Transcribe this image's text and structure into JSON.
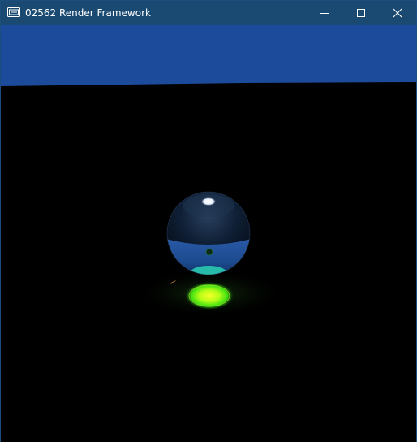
{
  "window": {
    "title": "02562 Render Framework",
    "icon": "app-window-icon",
    "buttons": [
      {
        "name": "minimize-button",
        "icon": "minimize-icon"
      },
      {
        "name": "maximize-button",
        "icon": "maximize-icon"
      },
      {
        "name": "close-button",
        "icon": "close-icon"
      }
    ]
  },
  "scene": {
    "sky_color": "#1d4b9b",
    "floor_color": "#000000",
    "sphere_color": "#1e4f93",
    "glow_color": "#4cff1a",
    "highlight_color": "#ffffff",
    "caustic_color": "#2ad4b4"
  }
}
